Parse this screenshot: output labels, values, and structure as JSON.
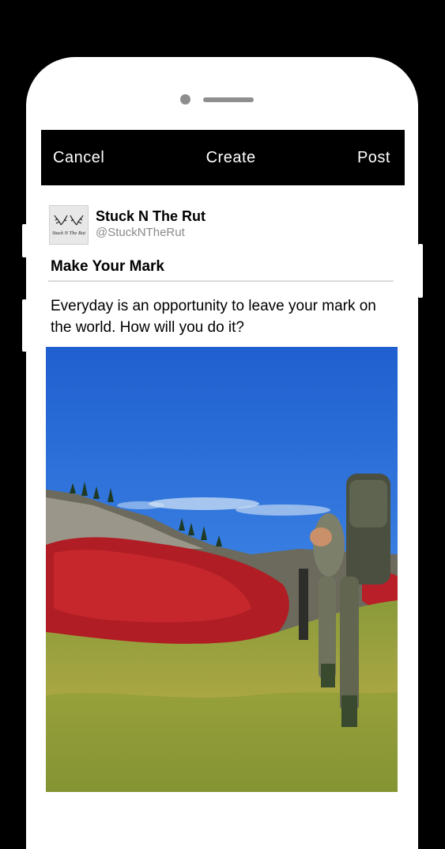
{
  "nav": {
    "cancel_label": "Cancel",
    "title": "Create",
    "post_label": "Post"
  },
  "profile": {
    "name": "Stuck N The Rut",
    "handle": "@StuckNTheRut",
    "logo_text": "Stuck N The Rut"
  },
  "post": {
    "title": "Make Your Mark",
    "body": "Everyday is an opportunity to leave your mark on the world. How will you do it?"
  }
}
